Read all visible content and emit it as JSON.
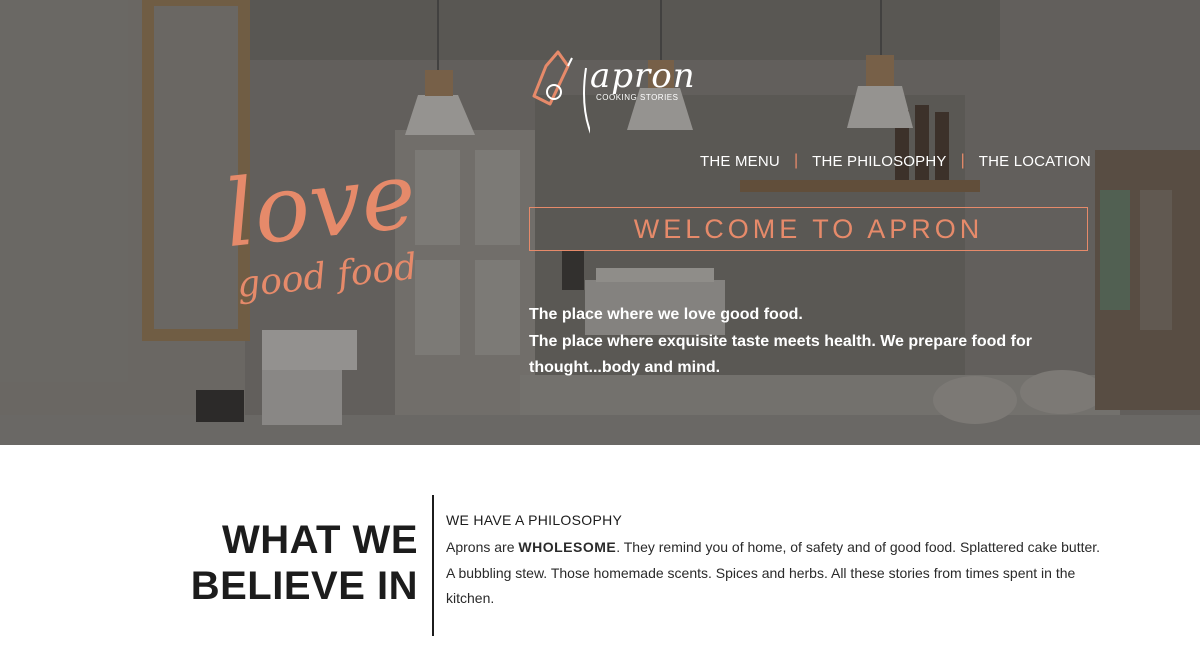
{
  "brand": {
    "name": "apron",
    "tagline": "COOKING STORIES"
  },
  "hero": {
    "script_line1": "love",
    "script_line2": "good food."
  },
  "nav": {
    "items": [
      {
        "label": "THE MENU"
      },
      {
        "label": "THE PHILOSOPHY"
      },
      {
        "label": "THE LOCATION"
      }
    ],
    "separator": "|"
  },
  "welcome": {
    "title": "WELCOME TO APRON"
  },
  "intro": {
    "line1": "The place where we love good food.",
    "line2": "The place where exquisite taste meets health. We prepare food for thought...body and mind."
  },
  "belief": {
    "heading_line1": "WHAT WE",
    "heading_line2": "BELIEVE IN",
    "kicker": "WE HAVE A PHILOSOPHY",
    "body_before": "Aprons are ",
    "body_emphasis": "WHOLESOME",
    "body_after": ". They remind you of home, of safety and of good food. Splattered cake butter. A bubbling stew. Those homemade scents. Spices and herbs. All these stories from times spent in the kitchen."
  },
  "colors": {
    "accent": "#e68a6a",
    "text_dark": "#1c1c1c",
    "hero_overlay": "#28262499"
  },
  "icons": {
    "logo_mark": "apron-logo-icon"
  }
}
